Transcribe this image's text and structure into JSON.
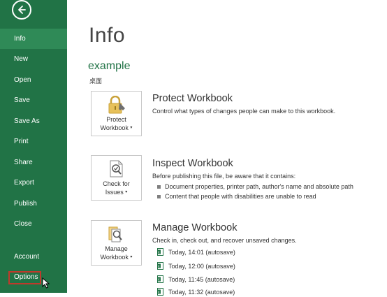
{
  "sidebar": {
    "items": [
      {
        "label": "Info"
      },
      {
        "label": "New"
      },
      {
        "label": "Open"
      },
      {
        "label": "Save"
      },
      {
        "label": "Save As"
      },
      {
        "label": "Print"
      },
      {
        "label": "Share"
      },
      {
        "label": "Export"
      },
      {
        "label": "Publish"
      },
      {
        "label": "Close"
      },
      {
        "label": "Account"
      },
      {
        "label": "Options"
      }
    ],
    "color": "#217346"
  },
  "main": {
    "title": "Info",
    "file_name": "example",
    "file_path": "桌面",
    "protect": {
      "button_line1": "Protect",
      "button_line2": "Workbook",
      "title": "Protect Workbook",
      "description": "Control what types of changes people can make to this workbook."
    },
    "inspect": {
      "button_line1": "Check for",
      "button_line2": "Issues",
      "title": "Inspect Workbook",
      "description": "Before publishing this file, be aware that it contains:",
      "bullets": [
        "Document properties, printer path, author's name and absolute path",
        "Content that people with disabilities are unable to read"
      ]
    },
    "manage": {
      "button_line1": "Manage",
      "button_line2": "Workbook",
      "title": "Manage Workbook",
      "description": "Check in, check out, and recover unsaved changes.",
      "versions": [
        "Today, 14:01 (autosave)",
        "Today, 12:00 (autosave)",
        "Today, 11:45 (autosave)",
        "Today, 11:32 (autosave)"
      ]
    }
  }
}
